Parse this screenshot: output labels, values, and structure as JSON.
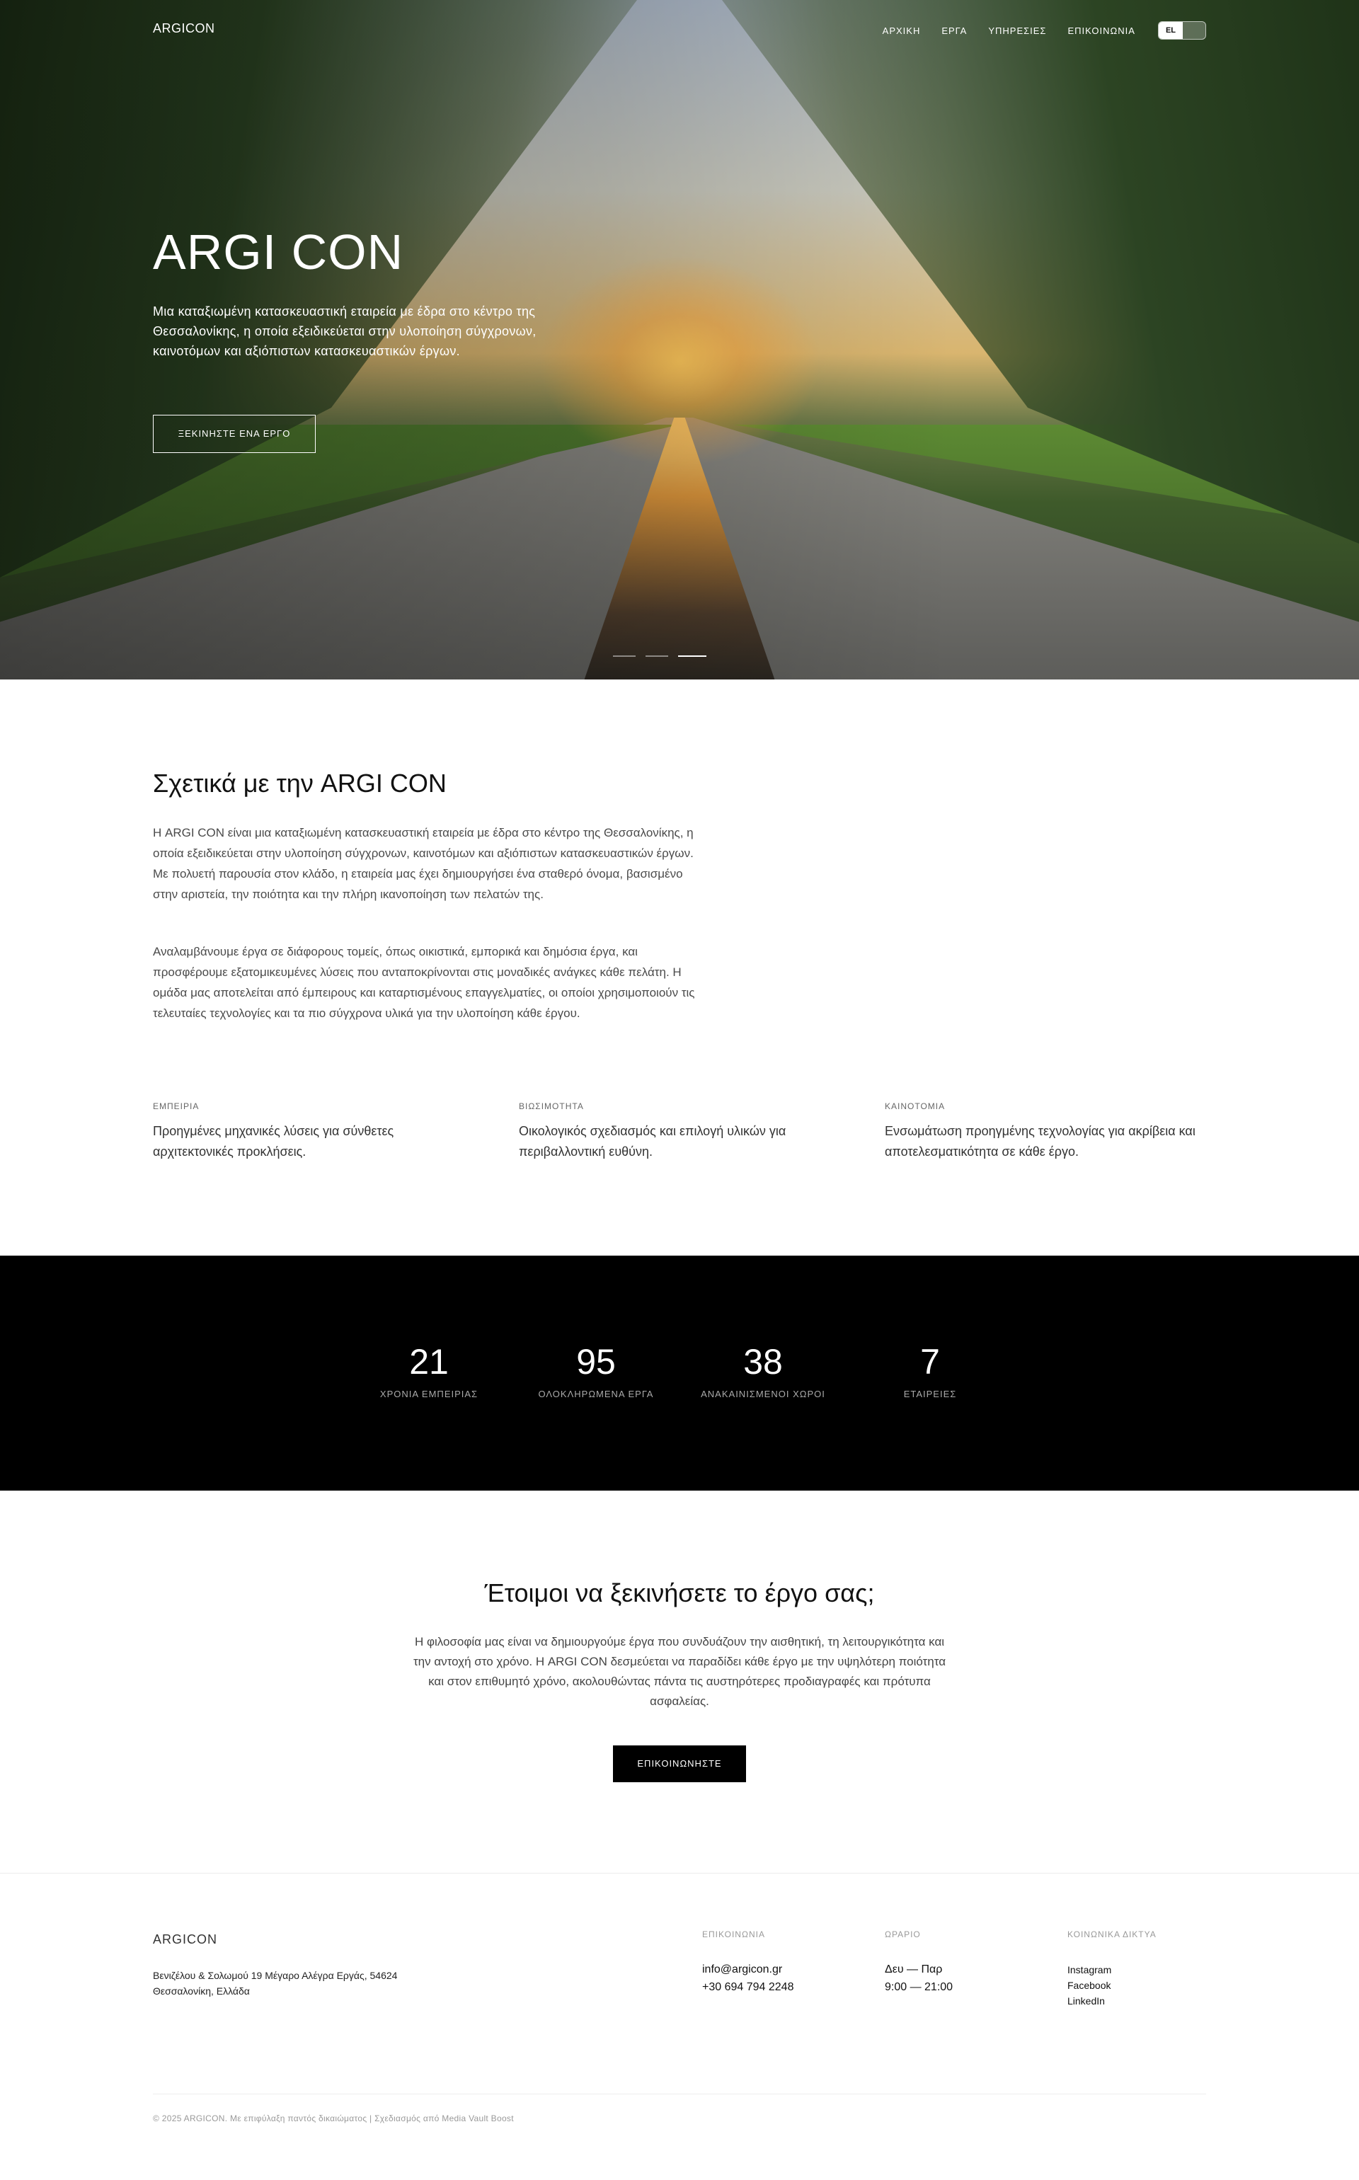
{
  "header": {
    "logo": "ARGICON",
    "nav": [
      "ΑΡΧΙΚΗ",
      "ΕΡΓΑ",
      "ΥΠΗΡΕΣΙΕΣ",
      "ΕΠΙΚΟΙΝΩΝΙΑ"
    ],
    "lang_active": "EL"
  },
  "hero": {
    "title": "ARGI CON",
    "description": "Μια καταξιωμένη κατασκευαστική εταιρεία με έδρα στο κέντρο της Θεσσαλονίκης, η οποία εξειδικεύεται στην υλοποίηση σύγχρονων, καινοτόμων και αξιόπιστων κατασκευαστικών έργων.",
    "button": "ΞΕΚΙΝΗΣΤΕ ΕΝΑ ΕΡΓΟ",
    "slides": 3,
    "active_slide": 3
  },
  "about": {
    "title": "Σχετικά με την ARGI CON",
    "p1": "Η ARGI CON είναι μια καταξιωμένη κατασκευαστική εταιρεία με έδρα στο κέντρο της Θεσσαλονίκης, η οποία εξειδικεύεται στην υλοποίηση σύγχρονων, καινοτόμων και αξιόπιστων κατασκευαστικών έργων. Με πολυετή παρουσία στον κλάδο, η εταιρεία μας έχει δημιουργήσει ένα σταθερό όνομα, βασισμένο στην αριστεία, την ποιότητα και την πλήρη ικανοποίηση των πελατών της.",
    "p2": "Αναλαμβάνουμε έργα σε διάφορους τομείς, όπως οικιστικά, εμπορικά και δημόσια έργα, και προσφέρουμε εξατομικευμένες λύσεις που ανταποκρίνονται στις μοναδικές ανάγκες κάθε πελάτη. Η ομάδα μας αποτελείται από έμπειρους και καταρτισμένους επαγγελματίες, οι οποίοι χρησιμοποιούν τις τελευταίες τεχνολογίες και τα πιο σύγχρονα υλικά για την υλοποίηση κάθε έργου.",
    "features": [
      {
        "label": "ΕΜΠΕΙΡΙΑ",
        "text": "Προηγμένες μηχανικές λύσεις για σύνθετες αρχιτεκτονικές προκλήσεις."
      },
      {
        "label": "ΒΙΩΣΙΜΟΤΗΤΑ",
        "text": "Οικολογικός σχεδιασμός και επιλογή υλικών για περιβαλλοντική ευθύνη."
      },
      {
        "label": "ΚΑΙΝΟΤΟΜΙΑ",
        "text": "Ενσωμάτωση προηγμένης τεχνολογίας για ακρίβεια και αποτελεσματικότητα σε κάθε έργο."
      }
    ]
  },
  "stats": [
    {
      "value": "21",
      "label": "ΧΡΟΝΙΑ ΕΜΠΕΙΡΙΑΣ"
    },
    {
      "value": "95",
      "label": "ΟΛΟΚΛΗΡΩΜΕΝΑ ΕΡΓΑ"
    },
    {
      "value": "38",
      "label": "ΑΝΑΚΑΙΝΙΣΜΕΝΟΙ ΧΩΡΟΙ"
    },
    {
      "value": "7",
      "label": "ΕΤΑΙΡΕΙΕΣ"
    }
  ],
  "cta": {
    "title": "Έτοιμοι να ξεκινήσετε το έργο σας;",
    "description": "Η φιλοσοφία μας είναι να δημιουργούμε έργα που συνδυάζουν την αισθητική, τη λειτουργικότητα και την αντοχή στο χρόνο. Η ARGI CON δεσμεύεται να παραδίδει κάθε έργο με την υψηλότερη ποιότητα και στον επιθυμητό χρόνο, ακολουθώντας πάντα τις αυστηρότερες προδιαγραφές και πρότυπα ασφαλείας.",
    "button": "ΕΠΙΚΟΙΝΩΝΗΣΤΕ"
  },
  "footer": {
    "logo": "ARGICON",
    "address_line1": "Βενιζέλου & Σολωμού 19 Μέγαρο Αλέγρα Εργάς, 54624",
    "address_line2": "Θεσσαλονίκη, Ελλάδα",
    "contact_label": "ΕΠΙΚΟΙΝΩΝΙΑ",
    "email": "info@argicon.gr",
    "phone": "+30 694 794 2248",
    "hours_label": "ΩΡΑΡΙΟ",
    "days": "Δευ — Παρ",
    "hours": "9:00 — 21:00",
    "social_label": "ΚΟΙΝΩΝΙΚΑ ΔΙΚΤΥΑ",
    "social": [
      "Instagram",
      "Facebook",
      "LinkedIn"
    ],
    "copyright": "© 2025 ARGICON. Με επιφύλαξη παντός δικαιώματος | Σχεδιασμός από Media Vault Boost"
  }
}
